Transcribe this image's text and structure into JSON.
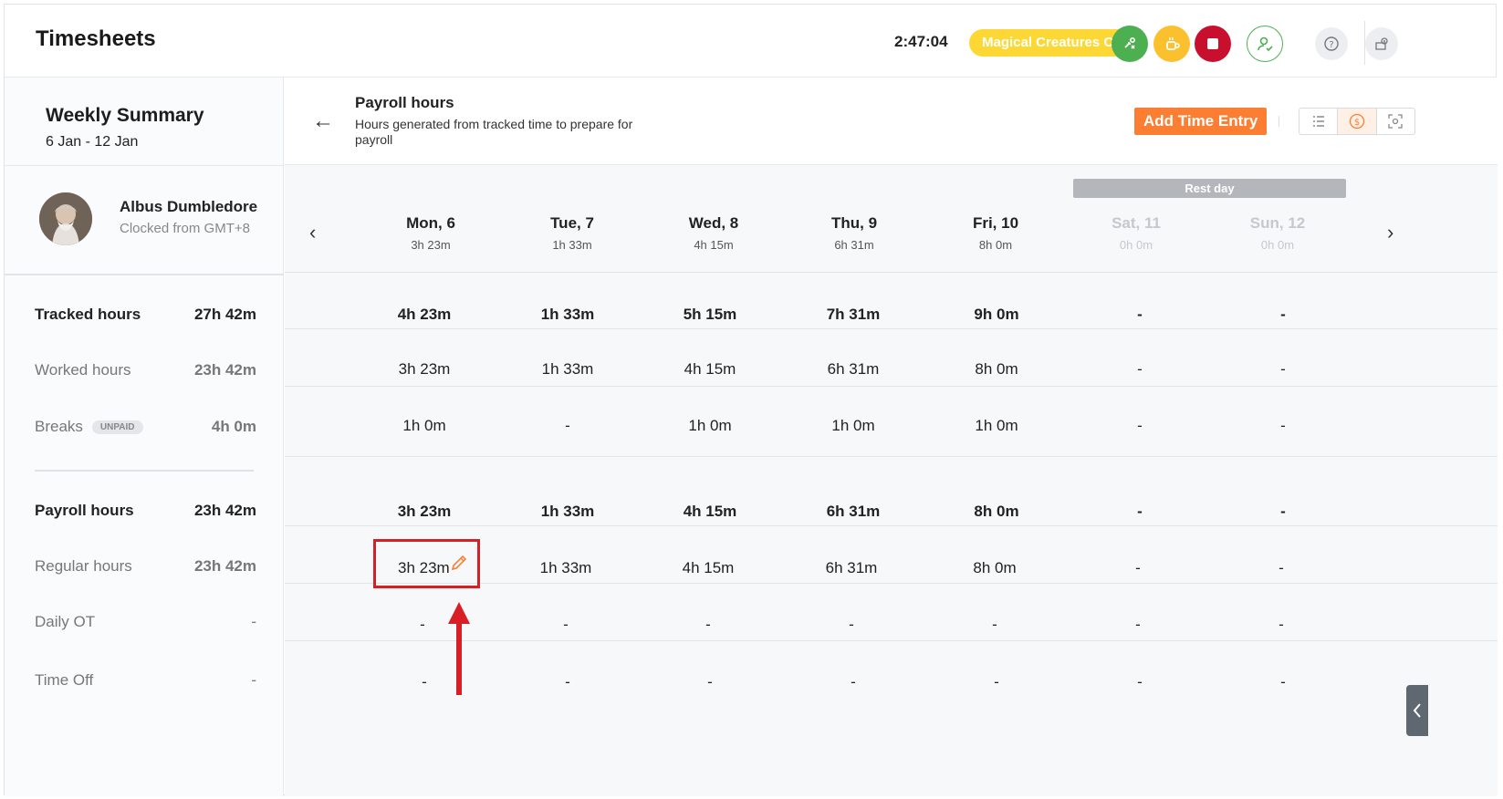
{
  "header": {
    "title": "Timesheets",
    "clock": "2:47:04",
    "project": "Magical Creatures Care",
    "icons": [
      "switch-task-icon",
      "break-icon",
      "stop-icon",
      "user-status-icon",
      "help-icon",
      "settings-icon"
    ]
  },
  "summary": {
    "title": "Weekly Summary",
    "range": "6 Jan - 12 Jan"
  },
  "user": {
    "name": "Albus Dumbledore",
    "timezone": "Clocked from GMT+8"
  },
  "panel": {
    "back": "←",
    "title": "Payroll hours",
    "description": "Hours generated from tracked time to prepare for payroll",
    "add_button": "Add Time Entry"
  },
  "rest_day_label": "Rest day",
  "days": [
    {
      "name": "Mon, 6",
      "total": "3h 23m"
    },
    {
      "name": "Tue, 7",
      "total": "1h 33m"
    },
    {
      "name": "Wed, 8",
      "total": "4h 15m"
    },
    {
      "name": "Thu, 9",
      "total": "6h 31m"
    },
    {
      "name": "Fri, 10",
      "total": "8h 0m"
    },
    {
      "name": "Sat, 11",
      "total": "0h 0m"
    },
    {
      "name": "Sun, 12",
      "total": "0h 0m"
    }
  ],
  "rows": [
    {
      "label": "Tracked hours",
      "total": "27h 42m",
      "values": [
        "4h 23m",
        "1h 33m",
        "5h 15m",
        "7h 31m",
        "9h 0m",
        "-",
        "-"
      ]
    },
    {
      "label": "Worked hours",
      "total": "23h 42m",
      "values": [
        "3h 23m",
        "1h 33m",
        "4h 15m",
        "6h 31m",
        "8h 0m",
        "-",
        "-"
      ]
    },
    {
      "label": "Breaks",
      "badge": "UNPAID",
      "total": "4h 0m",
      "values": [
        "1h 0m",
        "-",
        "1h 0m",
        "1h 0m",
        "1h 0m",
        "-",
        "-"
      ]
    },
    {
      "label": "Payroll hours",
      "total": "23h 42m",
      "values": [
        "3h 23m",
        "1h 33m",
        "4h 15m",
        "6h 31m",
        "8h 0m",
        "-",
        "-"
      ]
    },
    {
      "label": "Regular hours",
      "total": "23h 42m",
      "values": [
        "3h 23m",
        "1h 33m",
        "4h 15m",
        "6h 31m",
        "8h 0m",
        "-",
        "-"
      ]
    },
    {
      "label": "Daily OT",
      "total": "-",
      "values": [
        "-",
        "-",
        "-",
        "-",
        "-",
        "-",
        "-"
      ]
    },
    {
      "label": "Time Off",
      "total": "-",
      "values": [
        "-",
        "-",
        "-",
        "-",
        "-",
        "-",
        "-"
      ]
    }
  ],
  "colors": {
    "accent": "#fb7e33",
    "project_pill": "#fdd835",
    "highlight": "#d91f26",
    "green": "#4caf50",
    "yellow": "#fbc02d",
    "red": "#c8102e"
  }
}
